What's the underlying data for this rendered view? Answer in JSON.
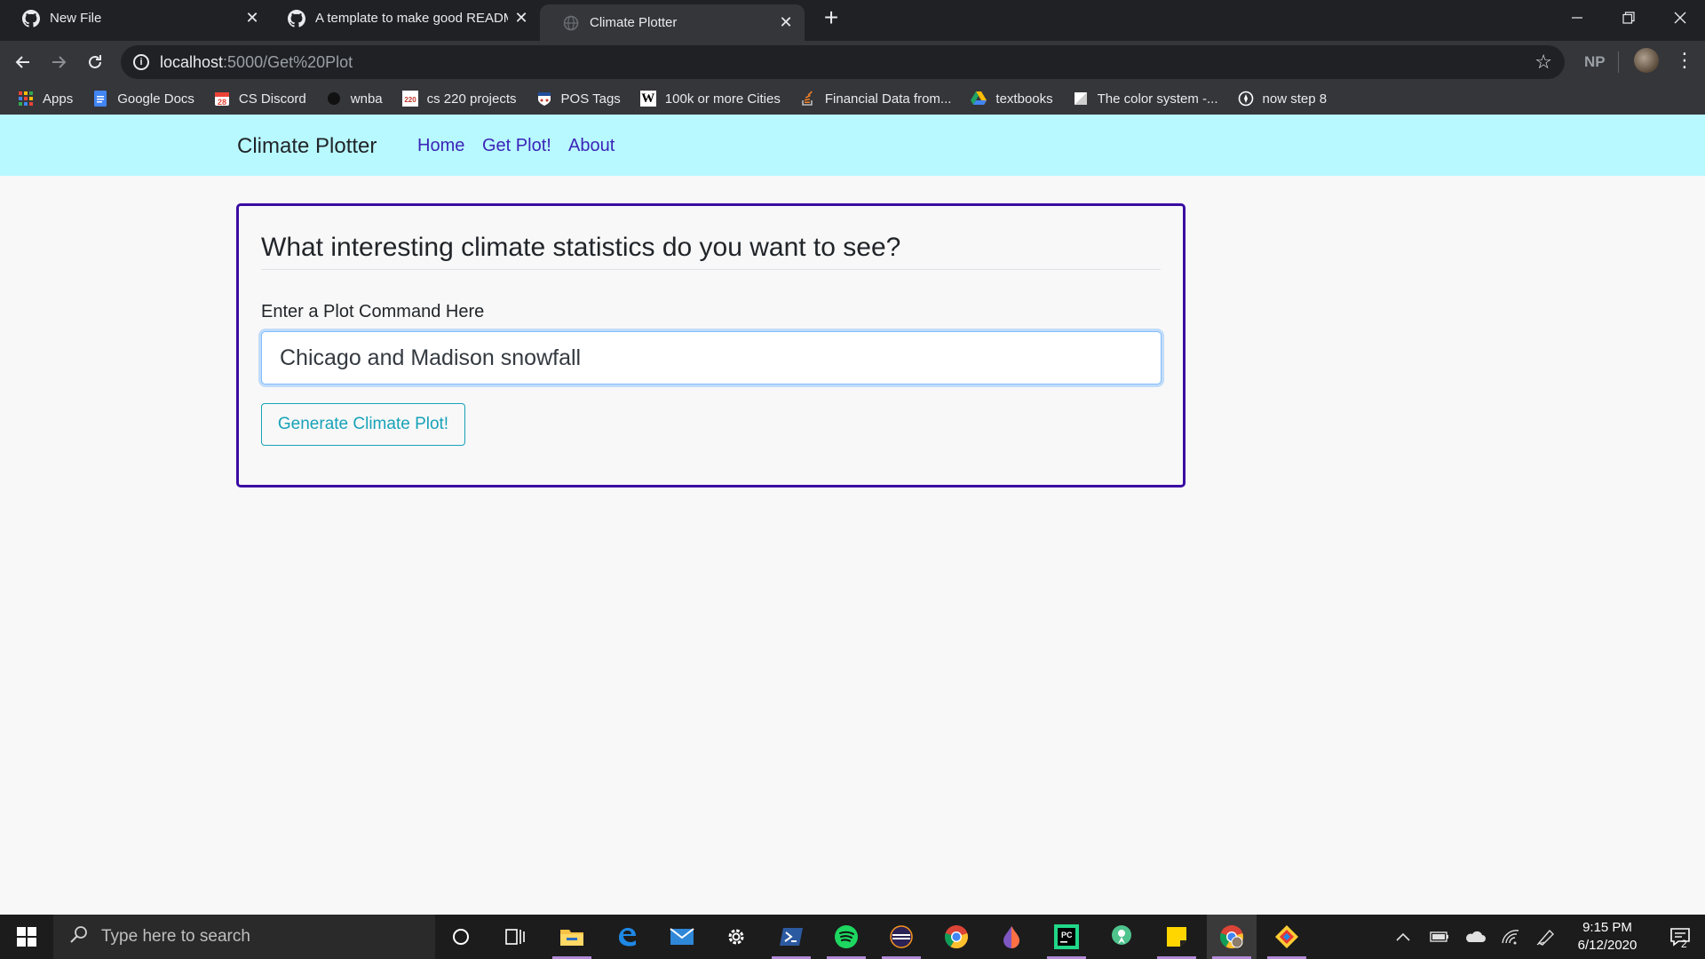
{
  "browser": {
    "tabs": [
      {
        "title": "New File",
        "icon": "github-icon",
        "active": false
      },
      {
        "title": "A template to make good READM",
        "icon": "github-icon",
        "active": false
      },
      {
        "title": "Climate Plotter",
        "icon": "globe-icon",
        "active": true
      }
    ],
    "url_host": "localhost",
    "url_path": ":5000/Get%20Plot",
    "profile_initials": "NP",
    "bookmarks": [
      {
        "label": "Apps",
        "icon": "apps-grid-icon",
        "color": "#ea4335"
      },
      {
        "label": "Google Docs",
        "icon": "google-docs-icon",
        "color": "#4285f4"
      },
      {
        "label": "CS Discord",
        "icon": "calendar-icon",
        "color": "#ea4335"
      },
      {
        "label": "wnba",
        "icon": "basketball-icon",
        "color": "#111111"
      },
      {
        "label": "cs 220 projects",
        "icon": "cs220-icon",
        "color": "#c0392b"
      },
      {
        "label": "POS Tags",
        "icon": "penn-icon",
        "color": "#1f4e9b"
      },
      {
        "label": "100k or more Cities",
        "icon": "wikipedia-icon",
        "color": "#ffffff"
      },
      {
        "label": "Financial Data from...",
        "icon": "stackoverflow-icon",
        "color": "#f48024"
      },
      {
        "label": "textbooks",
        "icon": "google-drive-icon",
        "color": "#1fa463"
      },
      {
        "label": "The color system -...",
        "icon": "material-icon",
        "color": "#ffffff"
      },
      {
        "label": "now step 8",
        "icon": "compass-icon",
        "color": "#ffffff"
      }
    ]
  },
  "navbar": {
    "brand": "Climate Plotter",
    "links": [
      "Home",
      "Get Plot!",
      "About"
    ]
  },
  "form": {
    "heading": "What interesting climate statistics do you want to see?",
    "label": "Enter a Plot Command Here",
    "input_value": "Chicago and Madison snowfall",
    "button": "Generate Climate Plot!"
  },
  "taskbar": {
    "search_placeholder": "Type here to search",
    "time": "9:15 PM",
    "date": "6/12/2020",
    "notification_count": "2"
  }
}
